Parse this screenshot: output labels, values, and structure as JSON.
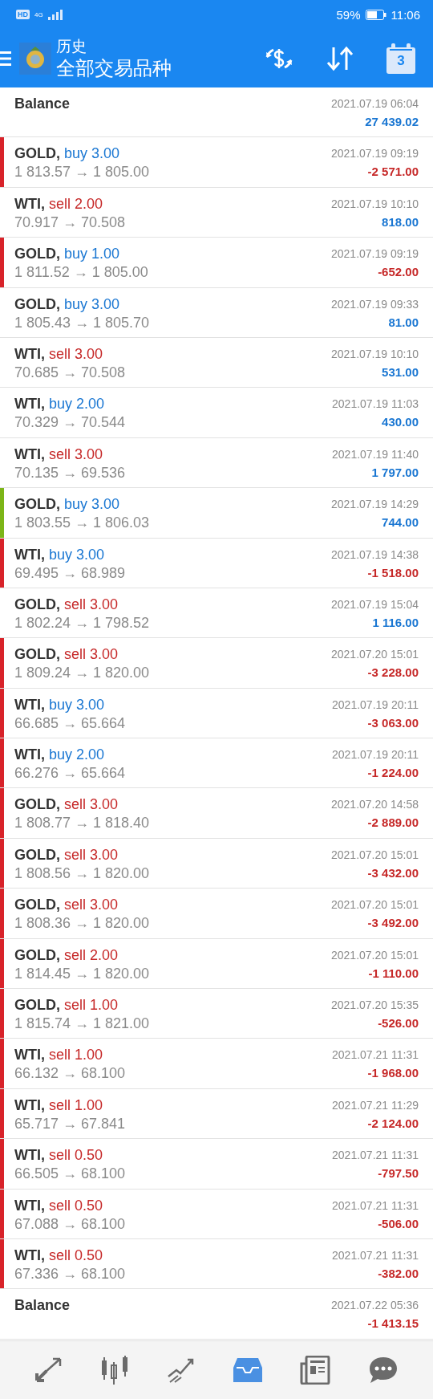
{
  "status_bar": {
    "hd": "HD",
    "network": "4G",
    "battery": "59%",
    "time": "11:06"
  },
  "header": {
    "title": "历史",
    "subtitle": "全部交易品种",
    "calendar_day": "3"
  },
  "rows": [
    {
      "kind": "balance",
      "symbol": "Balance",
      "time": "2021.07.19 06:04",
      "profit": "27 439.02",
      "loss": false
    },
    {
      "kind": "trade",
      "symbol": "GOLD,",
      "side": "buy",
      "volume": "3.00",
      "prices": "1 813.57 → 1 805.00",
      "time": "2021.07.19 09:19",
      "profit": "-2 571.00",
      "loss": true,
      "color": "#d8232a"
    },
    {
      "kind": "trade",
      "symbol": "WTI,",
      "side": "sell",
      "volume": "2.00",
      "prices": "70.917 → 70.508",
      "time": "2021.07.19 10:10",
      "profit": "818.00",
      "loss": false
    },
    {
      "kind": "trade",
      "symbol": "GOLD,",
      "side": "buy",
      "volume": "1.00",
      "prices": "1 811.52 → 1 805.00",
      "time": "2021.07.19 09:19",
      "profit": "-652.00",
      "loss": true,
      "color": "#d8232a"
    },
    {
      "kind": "trade",
      "symbol": "GOLD,",
      "side": "buy",
      "volume": "3.00",
      "prices": "1 805.43 → 1 805.70",
      "time": "2021.07.19 09:33",
      "profit": "81.00",
      "loss": false
    },
    {
      "kind": "trade",
      "symbol": "WTI,",
      "side": "sell",
      "volume": "3.00",
      "prices": "70.685 → 70.508",
      "time": "2021.07.19 10:10",
      "profit": "531.00",
      "loss": false
    },
    {
      "kind": "trade",
      "symbol": "WTI,",
      "side": "buy",
      "volume": "2.00",
      "prices": "70.329 → 70.544",
      "time": "2021.07.19 11:03",
      "profit": "430.00",
      "loss": false
    },
    {
      "kind": "trade",
      "symbol": "WTI,",
      "side": "sell",
      "volume": "3.00",
      "prices": "70.135 → 69.536",
      "time": "2021.07.19 11:40",
      "profit": "1 797.00",
      "loss": false
    },
    {
      "kind": "trade",
      "symbol": "GOLD,",
      "side": "buy",
      "volume": "3.00",
      "prices": "1 803.55 → 1 806.03",
      "time": "2021.07.19 14:29",
      "profit": "744.00",
      "loss": false,
      "color": "#7cb518"
    },
    {
      "kind": "trade",
      "symbol": "WTI,",
      "side": "buy",
      "volume": "3.00",
      "prices": "69.495 → 68.989",
      "time": "2021.07.19 14:38",
      "profit": "-1 518.00",
      "loss": true,
      "color": "#d8232a"
    },
    {
      "kind": "trade",
      "symbol": "GOLD,",
      "side": "sell",
      "volume": "3.00",
      "prices": "1 802.24 → 1 798.52",
      "time": "2021.07.19 15:04",
      "profit": "1 116.00",
      "loss": false
    },
    {
      "kind": "trade",
      "symbol": "GOLD,",
      "side": "sell",
      "volume": "3.00",
      "prices": "1 809.24 → 1 820.00",
      "time": "2021.07.20 15:01",
      "profit": "-3 228.00",
      "loss": true,
      "color": "#d8232a"
    },
    {
      "kind": "trade",
      "symbol": "WTI,",
      "side": "buy",
      "volume": "3.00",
      "prices": "66.685 → 65.664",
      "time": "2021.07.19 20:11",
      "profit": "-3 063.00",
      "loss": true,
      "color": "#d8232a"
    },
    {
      "kind": "trade",
      "symbol": "WTI,",
      "side": "buy",
      "volume": "2.00",
      "prices": "66.276 → 65.664",
      "time": "2021.07.19 20:11",
      "profit": "-1 224.00",
      "loss": true,
      "color": "#d8232a"
    },
    {
      "kind": "trade",
      "symbol": "GOLD,",
      "side": "sell",
      "volume": "3.00",
      "prices": "1 808.77 → 1 818.40",
      "time": "2021.07.20 14:58",
      "profit": "-2 889.00",
      "loss": true,
      "color": "#d8232a"
    },
    {
      "kind": "trade",
      "symbol": "GOLD,",
      "side": "sell",
      "volume": "3.00",
      "prices": "1 808.56 → 1 820.00",
      "time": "2021.07.20 15:01",
      "profit": "-3 432.00",
      "loss": true,
      "color": "#d8232a"
    },
    {
      "kind": "trade",
      "symbol": "GOLD,",
      "side": "sell",
      "volume": "3.00",
      "prices": "1 808.36 → 1 820.00",
      "time": "2021.07.20 15:01",
      "profit": "-3 492.00",
      "loss": true,
      "color": "#d8232a"
    },
    {
      "kind": "trade",
      "symbol": "GOLD,",
      "side": "sell",
      "volume": "2.00",
      "prices": "1 814.45 → 1 820.00",
      "time": "2021.07.20 15:01",
      "profit": "-1 110.00",
      "loss": true,
      "color": "#d8232a"
    },
    {
      "kind": "trade",
      "symbol": "GOLD,",
      "side": "sell",
      "volume": "1.00",
      "prices": "1 815.74 → 1 821.00",
      "time": "2021.07.20 15:35",
      "profit": "-526.00",
      "loss": true,
      "color": "#d8232a"
    },
    {
      "kind": "trade",
      "symbol": "WTI,",
      "side": "sell",
      "volume": "1.00",
      "prices": "66.132 → 68.100",
      "time": "2021.07.21 11:31",
      "profit": "-1 968.00",
      "loss": true,
      "color": "#d8232a"
    },
    {
      "kind": "trade",
      "symbol": "WTI,",
      "side": "sell",
      "volume": "1.00",
      "prices": "65.717 → 67.841",
      "time": "2021.07.21 11:29",
      "profit": "-2 124.00",
      "loss": true,
      "color": "#d8232a"
    },
    {
      "kind": "trade",
      "symbol": "WTI,",
      "side": "sell",
      "volume": "0.50",
      "prices": "66.505 → 68.100",
      "time": "2021.07.21 11:31",
      "profit": "-797.50",
      "loss": true,
      "color": "#d8232a"
    },
    {
      "kind": "trade",
      "symbol": "WTI,",
      "side": "sell",
      "volume": "0.50",
      "prices": "67.088 → 68.100",
      "time": "2021.07.21 11:31",
      "profit": "-506.00",
      "loss": true,
      "color": "#d8232a"
    },
    {
      "kind": "trade",
      "symbol": "WTI,",
      "side": "sell",
      "volume": "0.50",
      "prices": "67.336 → 68.100",
      "time": "2021.07.21 11:31",
      "profit": "-382.00",
      "loss": true,
      "color": "#d8232a"
    },
    {
      "kind": "balance",
      "symbol": "Balance",
      "time": "2021.07.22 05:36",
      "profit": "-1 413.15",
      "loss": true
    }
  ],
  "nav": [
    {
      "kind": "trade",
      "selected": false
    },
    {
      "kind": "quotes",
      "selected": false
    },
    {
      "kind": "chart",
      "selected": false
    },
    {
      "kind": "history",
      "selected": true
    },
    {
      "kind": "news",
      "selected": false
    },
    {
      "kind": "chat",
      "selected": false
    }
  ]
}
